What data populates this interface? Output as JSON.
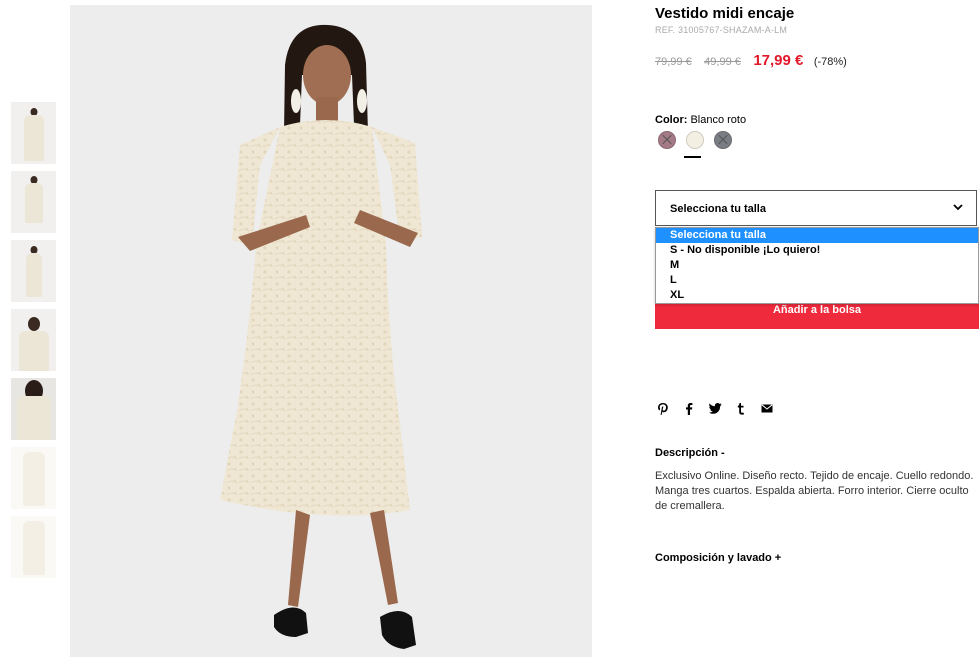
{
  "product": {
    "title": "Vestido midi encaje",
    "ref": "REF. 31005767-SHAZAM-A-LM",
    "original_price": "79,99 €",
    "previous_price": "49,99 €",
    "sale_price": "17,99 €",
    "discount": "(-78%)"
  },
  "color": {
    "label": "Color:",
    "selected": "Blanco roto",
    "swatches": [
      {
        "name": "rosa",
        "hex": "#a47a86",
        "available": false
      },
      {
        "name": "blanco roto",
        "hex": "#f3efe2",
        "available": true
      },
      {
        "name": "gris",
        "hex": "#7a7d83",
        "available": false
      }
    ]
  },
  "size": {
    "select_label": "Selecciona tu talla",
    "options": [
      "Selecciona tu talla",
      "S - No disponible ¡Lo quiero!",
      "M",
      "L",
      "XL"
    ],
    "selected_index": 0
  },
  "add_to_bag": "Añadir a la bolsa",
  "share_icons": [
    "pinterest-icon",
    "facebook-icon",
    "twitter-icon",
    "tumblr-icon",
    "email-icon"
  ],
  "description": {
    "heading": "Descripción -",
    "body": "Exclusivo Online. Diseño recto. Tejido de encaje. Cuello redondo. Manga tres cuartos. Espalda abierta. Forro interior. Cierre oculto de cremallera."
  },
  "composition": {
    "heading": "Composición y lavado +"
  },
  "colors": {
    "sale_red": "#e1192b",
    "button_red": "#ef2a3c",
    "dropdown_highlight": "#1e90ff"
  }
}
